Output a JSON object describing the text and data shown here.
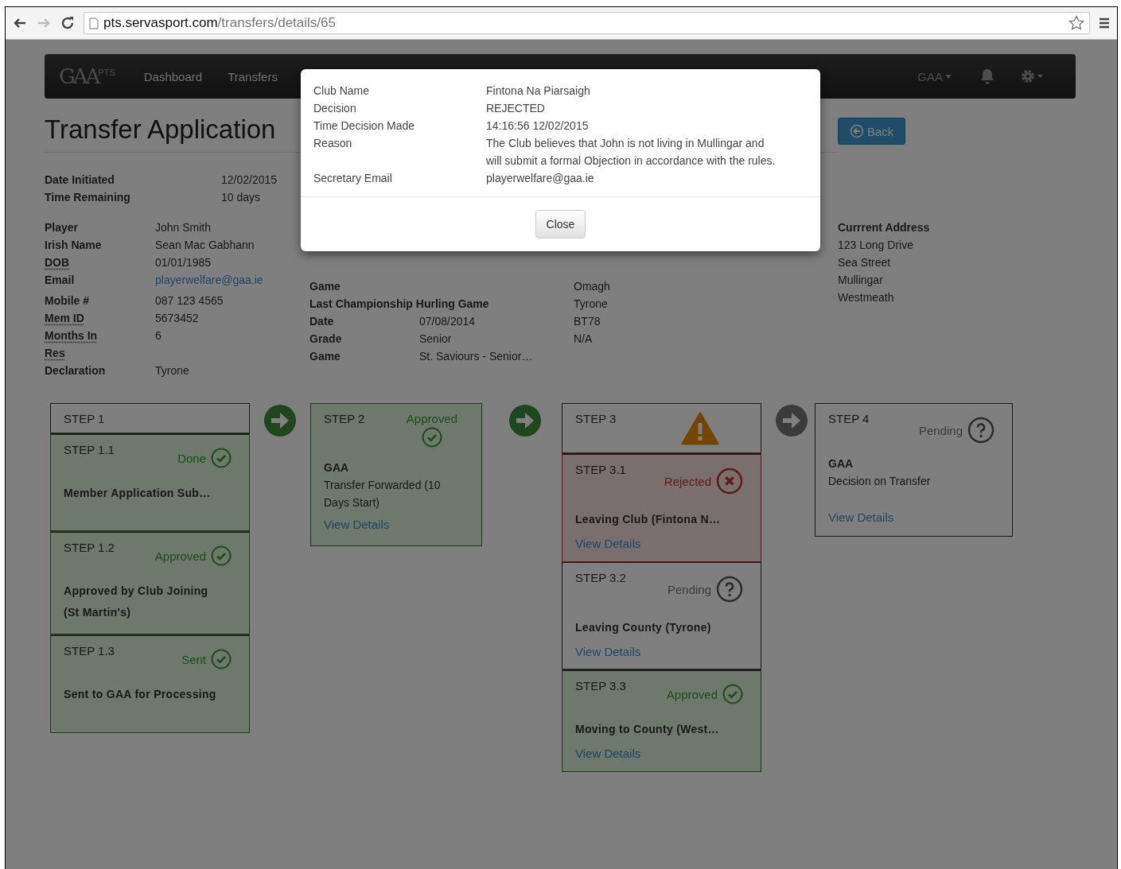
{
  "browser": {
    "nav_buttons": [
      {
        "kind": "back",
        "disabled": false
      },
      {
        "kind": "forward",
        "disabled": true
      }
    ],
    "url_host": "pts.servasport.com",
    "url_path": "/transfers/details/65"
  },
  "navbar": {
    "brand": "GAA",
    "brand_tag": "PTS",
    "links": [
      "Dashboard",
      "Transfers"
    ],
    "dropdown": "GAA"
  },
  "page": {
    "title": "Transfer Application",
    "back_button": "Back"
  },
  "summary": [
    {
      "label": "Date Initiated",
      "value": "12/02/2015"
    },
    {
      "label": "Time Remaining",
      "value": "10 days"
    }
  ],
  "player": [
    {
      "label": "Player",
      "value": "John Smith",
      "abbr": false
    },
    {
      "label": "Irish Name",
      "value": "Sean Mac Gabhann",
      "abbr": false
    },
    {
      "label": "DOB",
      "value": "01/01/1985",
      "abbr": true
    },
    {
      "label": "Email",
      "value": "playerwelfare@gaa.ie",
      "abbr": false,
      "kind": "link"
    },
    {
      "label": "Mobile #",
      "value": "087 123 4565",
      "abbr": false
    },
    {
      "label": "Mem ID",
      "value": "5673452",
      "abbr": true
    },
    {
      "label": "Months In Res",
      "value": "6",
      "abbr": true
    },
    {
      "label": "Declaration",
      "value": "Tyrone",
      "abbr": false
    }
  ],
  "club_details": [
    {
      "label": "Game",
      "column_3": "Omagh"
    },
    {
      "label": "Last Championship Hurling Game",
      "column_3": "Tyrone"
    },
    {
      "label": "Date",
      "value": "07/08/2014",
      "column_3": "BT78"
    },
    {
      "label": "Grade",
      "value": "Senior",
      "column_3": "N/A"
    },
    {
      "label": "Game",
      "value": "St. Saviours - Senior…"
    }
  ],
  "address": {
    "heading": "Currrent Address",
    "lines": [
      "123 Long Drive",
      "Sea Street",
      "Mullingar",
      "Westmeath"
    ]
  },
  "steps": [
    {
      "kind": "group",
      "arrow": {
        "kind": "complete"
      },
      "header": {
        "label": "STEP 1",
        "warning": false
      },
      "substeps": [
        {
          "label": "STEP 1.1",
          "status": {
            "kind": "approved",
            "label": "Done"
          },
          "title": "Member Application Sub…"
        },
        {
          "label": "STEP 1.2",
          "status": {
            "kind": "approved",
            "label": "Approved"
          },
          "title": "Approved by Club Joining (St Martin's)"
        },
        {
          "label": "STEP 1.3",
          "status": {
            "kind": "approved",
            "label": "Sent"
          },
          "title": "Sent to GAA for Processing"
        }
      ]
    },
    {
      "kind": "single",
      "arrow": {
        "kind": "complete"
      },
      "label": "STEP 2",
      "status": {
        "kind": "approved",
        "label": "Approved",
        "icon_below": true
      },
      "heading": "GAA",
      "text": "Transfer Forwarded (10 Days Start)",
      "link": "View Details"
    },
    {
      "kind": "group",
      "arrow": {
        "kind": "pending"
      },
      "header": {
        "label": "STEP 3",
        "warning": true
      },
      "substeps": [
        {
          "label": "STEP 3.1",
          "status": {
            "kind": "rejected",
            "label": "Rejected"
          },
          "title": "Leaving Club (Fintona N…",
          "link": "View Details"
        },
        {
          "label": "STEP 3.2",
          "status": {
            "kind": "pending",
            "label": "Pending"
          },
          "title": "Leaving County (Tyrone)",
          "link": "View Details"
        },
        {
          "label": "STEP 3.3",
          "status": {
            "kind": "approved",
            "label": "Approved"
          },
          "title": "Moving to County (West…",
          "link": "View Details"
        }
      ]
    },
    {
      "kind": "single",
      "label": "STEP 4",
      "status": {
        "kind": "pending",
        "label": "Pending",
        "icon_below": false
      },
      "heading": "GAA",
      "text": "Decision on Transfer",
      "link": "View Details"
    }
  ],
  "modal": {
    "rows": [
      {
        "label": "Club Name",
        "value": "Fintona Na Piarsaigh"
      },
      {
        "label": "Decision",
        "value": "REJECTED"
      },
      {
        "label": "Time Decision Made",
        "value": "14:16:56 12/02/2015"
      },
      {
        "label": "Reason",
        "value": "The Club believes that John is not living in Mullingar and will submit a formal Objection in accordance with the rules."
      },
      {
        "label": "Secretary Email",
        "value": "playerwelfare@gaa.ie"
      }
    ],
    "close_button": "Close"
  }
}
